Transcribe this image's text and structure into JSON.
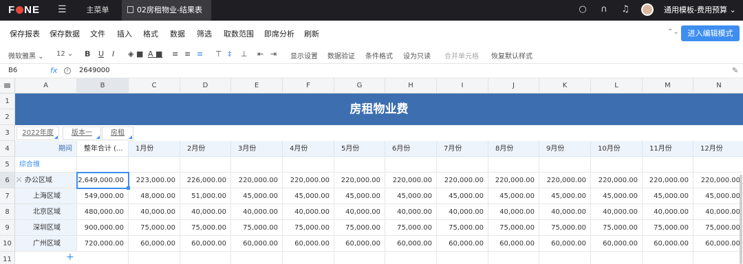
{
  "topbar": {
    "logo": "F NE",
    "menu_icon": "hamburger-icon",
    "tab_main": "主菜单",
    "tab_file": "02房租物业-结果表",
    "template_name": "通用模板-费用预算"
  },
  "actions": [
    "保存报表",
    "保存数据",
    "文件",
    "插入",
    "格式",
    "数据",
    "筛选",
    "取数范围",
    "即席分析",
    "刷新"
  ],
  "edit_button": "进入编辑模式",
  "format": {
    "font": "微软雅黑",
    "size": "12",
    "items": [
      "显示设置",
      "数据验证",
      "条件格式",
      "设为只读",
      "合并单元格",
      "恢复默认样式"
    ]
  },
  "formula": {
    "cell_ref": "B6",
    "value": "2649000"
  },
  "columns": [
    "A",
    "B",
    "C",
    "D",
    "E",
    "F",
    "G",
    "H",
    "I",
    "J",
    "K",
    "L",
    "M",
    "N"
  ],
  "rows": [
    "1",
    "2",
    "3",
    "4",
    "5",
    "6",
    "7",
    "8",
    "9",
    "10",
    "11"
  ],
  "sheet": {
    "title": "房租物业费",
    "filters": [
      "2022年度",
      "版本一",
      "房租"
    ],
    "period_label": "期间",
    "year_total": "整年合计 (...",
    "months": [
      "1月份",
      "2月份",
      "3月份",
      "4月份",
      "5月份",
      "6月份",
      "7月份",
      "8月份",
      "9月份",
      "10月份",
      "11月份",
      "12月份"
    ],
    "dimension_label": "综合维",
    "data_rows": [
      {
        "label": "办公区域",
        "values": [
          "2,649,000.00",
          "223,000.00",
          "226,000.00",
          "220,000.00",
          "220,000.00",
          "220,000.00",
          "220,000.00",
          "220,000.00",
          "220,000.00",
          "220,000.00",
          "220,000.00",
          "220,000.00",
          "220,000.00"
        ]
      },
      {
        "label": "上海区域",
        "values": [
          "549,000.00",
          "48,000.00",
          "51,000.00",
          "45,000.00",
          "45,000.00",
          "45,000.00",
          "45,000.00",
          "45,000.00",
          "45,000.00",
          "45,000.00",
          "45,000.00",
          "45,000.00",
          "45,000.00"
        ]
      },
      {
        "label": "北京区域",
        "values": [
          "480,000.00",
          "40,000.00",
          "40,000.00",
          "40,000.00",
          "40,000.00",
          "40,000.00",
          "40,000.00",
          "40,000.00",
          "40,000.00",
          "40,000.00",
          "40,000.00",
          "40,000.00",
          "40,000.00"
        ]
      },
      {
        "label": "深圳区域",
        "values": [
          "900,000.00",
          "75,000.00",
          "75,000.00",
          "75,000.00",
          "75,000.00",
          "75,000.00",
          "75,000.00",
          "75,000.00",
          "75,000.00",
          "75,000.00",
          "75,000.00",
          "75,000.00",
          "75,000.00"
        ]
      },
      {
        "label": "广州区域",
        "values": [
          "720,000.00",
          "60,000.00",
          "60,000.00",
          "60,000.00",
          "60,000.00",
          "60,000.00",
          "60,000.00",
          "60,000.00",
          "60,000.00",
          "60,000.00",
          "60,000.00",
          "60,000.00",
          "60,000.00"
        ]
      }
    ],
    "add_row": "+"
  }
}
